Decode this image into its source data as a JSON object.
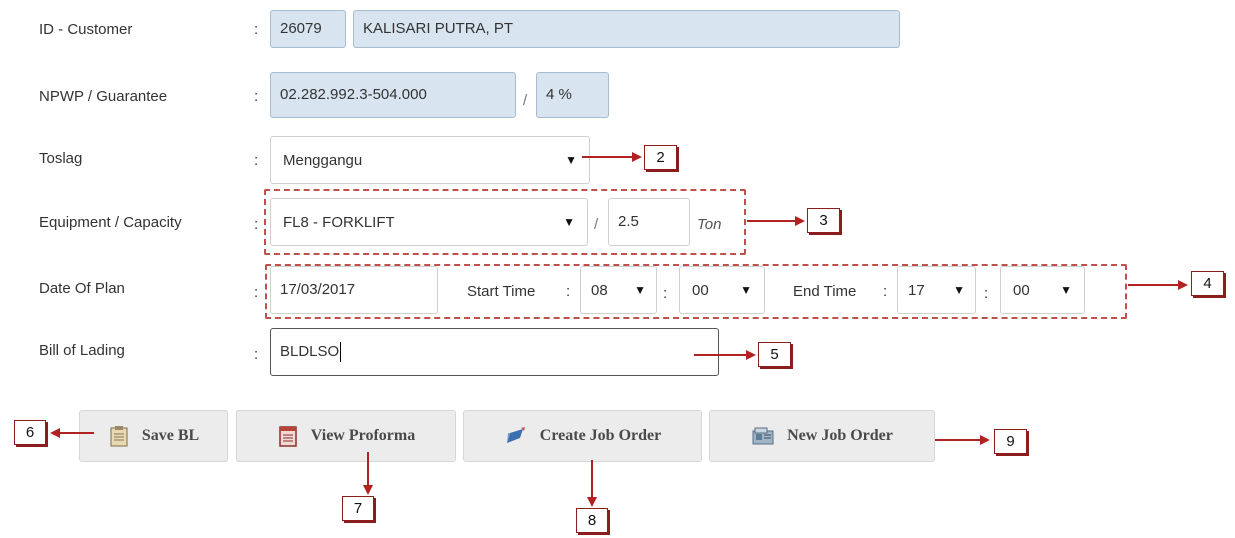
{
  "form": {
    "customer": {
      "label": "ID - Customer",
      "colon": ":",
      "id": "26079",
      "name": "KALISARI PUTRA, PT"
    },
    "npwp": {
      "label": "NPWP / Guarantee",
      "colon": ":",
      "value": "02.282.992.3-504.000",
      "separator": "/",
      "guarantee": "4 %"
    },
    "toslag": {
      "label": "Toslag",
      "colon": ":",
      "selected": "Menggangu"
    },
    "equipment": {
      "label": "Equipment / Capacity",
      "colon": ":",
      "selected": "FL8 - FORKLIFT",
      "separator": "/",
      "capacity": "2.5",
      "unit": "Ton"
    },
    "date_of_plan": {
      "label": "Date Of Plan",
      "colon": ":",
      "date": "17/03/2017",
      "start_label": "Start Time",
      "start_colon": ":",
      "start_hour": "08",
      "start_sep": ":",
      "start_minute": "00",
      "end_label": "End Time",
      "end_colon": ":",
      "end_hour": "17",
      "end_sep": ":",
      "end_minute": "00"
    },
    "bill_of_lading": {
      "label": "Bill of Lading",
      "colon": ":",
      "value": "BLDLSO"
    }
  },
  "buttons": {
    "save_bl": "Save BL",
    "view_proforma": "View Proforma",
    "create_job_order": "Create Job Order",
    "new_job_order": "New Job Order"
  },
  "callouts": [
    "2",
    "3",
    "4",
    "5",
    "6",
    "7",
    "8",
    "9"
  ],
  "colors": {
    "annotation": "#b22222",
    "readonly_field": "#d8e4f0",
    "dashed_border": "#c0504d"
  }
}
